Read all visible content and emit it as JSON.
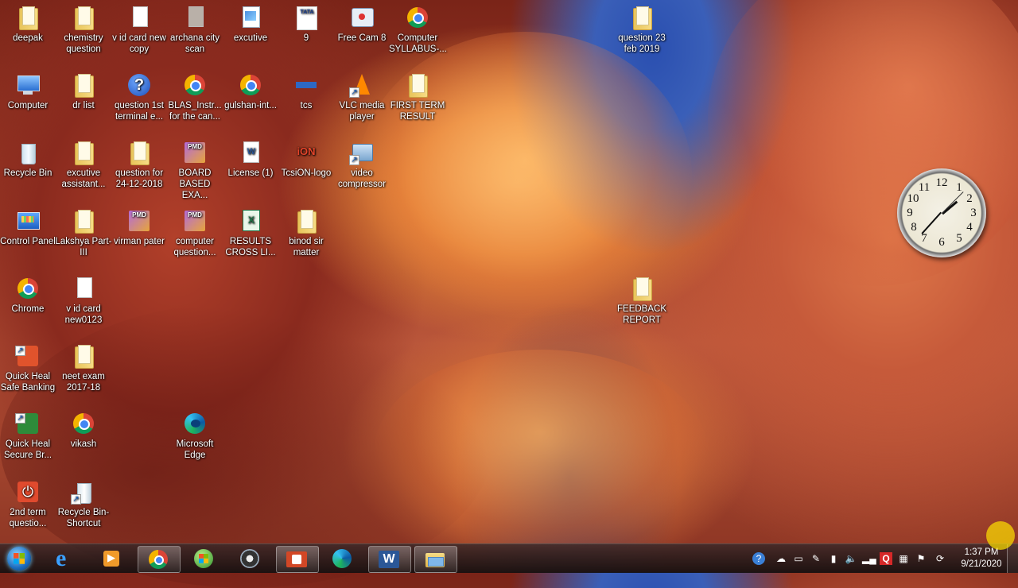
{
  "desktop_icons": [
    {
      "label": "deepak",
      "icon": "folder-icon"
    },
    {
      "label": "chemistry question",
      "icon": "folder-icon"
    },
    {
      "label": "v id card new copy",
      "icon": "document-icon"
    },
    {
      "label": "archana city scan",
      "icon": "image-file-icon"
    },
    {
      "label": "excutive",
      "icon": "sheet-icon"
    },
    {
      "label": "9",
      "icon": "tata-icon"
    },
    {
      "label": "Free Cam 8",
      "icon": "free-cam-icon"
    },
    {
      "label": "Computer SYLLABUS-...",
      "icon": "chrome-icon"
    },
    {
      "label": "question 23 feb 2019",
      "icon": "folder-icon"
    },
    {
      "label": "Computer",
      "icon": "computer-icon"
    },
    {
      "label": "dr list",
      "icon": "folder-icon"
    },
    {
      "label": "question 1st terminal e...",
      "icon": "help-icon"
    },
    {
      "label": "BLAS_Instr... for the can...",
      "icon": "chrome-icon"
    },
    {
      "label": "gulshan-int...",
      "icon": "chrome-icon"
    },
    {
      "label": "tcs",
      "icon": "tcs-icon"
    },
    {
      "label": "VLC media player",
      "icon": "vlc-icon"
    },
    {
      "label": "FIRST TERM RESULT",
      "icon": "folder-icon"
    },
    {
      "label": "Recycle Bin",
      "icon": "recycle-bin-icon"
    },
    {
      "label": "excutive assistant...",
      "icon": "folder-icon"
    },
    {
      "label": "question for 24-12-2018",
      "icon": "folder-icon"
    },
    {
      "label": "BOARD BASED EXA...",
      "icon": "pmd-icon"
    },
    {
      "label": "License (1)",
      "icon": "word-doc-icon"
    },
    {
      "label": "TcsiON-logo",
      "icon": "ion-icon"
    },
    {
      "label": "video compressor",
      "icon": "video-compressor-icon"
    },
    {
      "label": "Control Panel",
      "icon": "control-panel-icon"
    },
    {
      "label": "Lakshya Part-III",
      "icon": "folder-icon"
    },
    {
      "label": "virman pater",
      "icon": "pmd-icon"
    },
    {
      "label": "computer question...",
      "icon": "pmd-icon"
    },
    {
      "label": "RESULTS CROSS LI...",
      "icon": "excel-icon"
    },
    {
      "label": "binod sir matter",
      "icon": "folder-icon"
    },
    {
      "label": "FEEDBACK REPORT",
      "icon": "folder-icon"
    },
    {
      "label": "Chrome",
      "icon": "chrome-icon"
    },
    {
      "label": "v id card new0123",
      "icon": "document-icon"
    },
    {
      "label": "Quick Heal Safe Banking",
      "icon": "quick-heal-icon"
    },
    {
      "label": "neet exam 2017-18",
      "icon": "folder-icon"
    },
    {
      "label": "Quick Heal Secure Br...",
      "icon": "quick-heal-browser-icon"
    },
    {
      "label": "vikash",
      "icon": "chrome-icon"
    },
    {
      "label": "Microsoft Edge",
      "icon": "edge-icon"
    },
    {
      "label": "2nd term questio...",
      "icon": "power-icon"
    },
    {
      "label": "Recycle Bin-Shortcut",
      "icon": "recycle-bin-icon"
    }
  ],
  "clock_gadget": {
    "numbers": [
      "12",
      "1",
      "2",
      "3",
      "4",
      "5",
      "6",
      "7",
      "8",
      "9",
      "10",
      "11"
    ],
    "time": "1:37"
  },
  "taskbar": {
    "start_label": "Start",
    "pinned": [
      {
        "name": "internet-explorer",
        "icon": "ie-icon"
      },
      {
        "name": "media-player",
        "icon": "media-player-icon"
      },
      {
        "name": "chrome",
        "icon": "chrome-icon",
        "active": true
      },
      {
        "name": "windows-orb-app",
        "icon": "windows-icon"
      },
      {
        "name": "video-app",
        "icon": "video-reel-icon"
      },
      {
        "name": "powerpoint",
        "icon": "powerpoint-icon",
        "active": true
      },
      {
        "name": "edge",
        "icon": "edge-icon"
      },
      {
        "name": "word",
        "icon": "word-icon",
        "active": true
      },
      {
        "name": "explorer",
        "icon": "explorer-icon",
        "active": true
      }
    ],
    "clock_time": "1:37 PM",
    "clock_date": "9/21/2020"
  },
  "colors": {
    "taskbar": "#2a1d1d",
    "wallpaper_rock": "#c65a3a",
    "sky": "#2a4fb0"
  }
}
